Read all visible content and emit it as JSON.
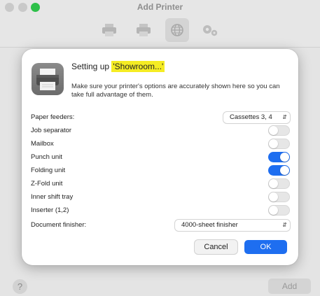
{
  "window": {
    "title": "Add Printer",
    "toolbar": [
      {
        "name": "default-printer-icon",
        "selected": false
      },
      {
        "name": "ip-printer-icon",
        "selected": false
      },
      {
        "name": "globe-icon",
        "selected": true
      },
      {
        "name": "advanced-gears-icon",
        "selected": false
      }
    ],
    "help_label": "?",
    "add_label": "Add"
  },
  "sheet": {
    "heading_prefix": "Setting up ",
    "heading_name": "'Showroom...'",
    "highlight_color": "#f5ec23",
    "description": "Make sure your printer's options are accurately shown here so you can take full advantage of them.",
    "paper_feeders": {
      "label": "Paper feeders:",
      "value": "Cassettes 3, 4"
    },
    "options": [
      {
        "label": "Job separator",
        "on": false
      },
      {
        "label": "Mailbox",
        "on": false
      },
      {
        "label": "Punch unit",
        "on": true
      },
      {
        "label": "Folding unit",
        "on": true
      },
      {
        "label": "Z-Fold unit",
        "on": false
      },
      {
        "label": "Inner shift tray",
        "on": false
      },
      {
        "label": "Inserter (1,2)",
        "on": false
      }
    ],
    "document_finisher": {
      "label": "Document finisher:",
      "value": "4000-sheet finisher"
    },
    "cancel_label": "Cancel",
    "ok_label": "OK",
    "accent_color": "#1e6ef0"
  }
}
